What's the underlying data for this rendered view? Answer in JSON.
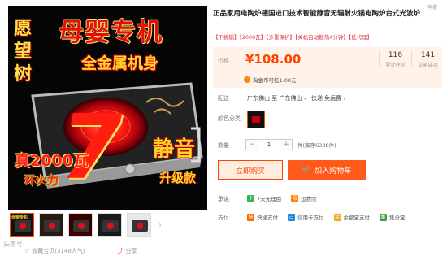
{
  "gallery": {
    "headline": "母婴专机",
    "sub_headline": "全金属机身",
    "brand_vertical": "愿望树",
    "power_text": "真2000瓦",
    "ring_text": "环火力",
    "quiet_text": "静音",
    "upgrade_text": "升级款",
    "seven": "7",
    "thumb_main_text": "母婴专机"
  },
  "share": {
    "favorite": "收藏宝贝(3148人气)",
    "share": "分享"
  },
  "watermark": "头条号",
  "report": "举报",
  "product": {
    "title": "正品家用电陶炉德国进口技术智能静音无辐射火锅电陶炉台式光波炉",
    "tags": "【不挑锅】【2000瓦】【多重保护】【关机自动散热4分钟】【低代理】"
  },
  "price": {
    "label": "价格",
    "value": "¥108.00",
    "reviews_count": "116",
    "reviews_label": "累计评论",
    "deals_count": "141",
    "deals_label": "交易成功",
    "coupon": "淘金币可抵1.08元"
  },
  "shipping": {
    "label": "配送",
    "from": "广东佛山",
    "to_word": "至",
    "to": "广东佛山",
    "method": "快递 免运费"
  },
  "color": {
    "label": "颜色分类"
  },
  "quantity": {
    "label": "数量",
    "minus": "−",
    "value": "1",
    "plus": "+",
    "stock": "件(库存6338件)"
  },
  "actions": {
    "buy": "立即购买",
    "cart": "加入购物车"
  },
  "promise": {
    "label": "承诺",
    "items": [
      "7天无理由",
      "运费险"
    ]
  },
  "payment": {
    "label": "支付",
    "items": [
      "快捷支付",
      "信用卡支付",
      "余额宝支付",
      "集分宝"
    ]
  },
  "colors": {
    "accent": "#ff4400",
    "price_bg": "#fff2e8",
    "cart_bg": "#ff5a1a"
  }
}
